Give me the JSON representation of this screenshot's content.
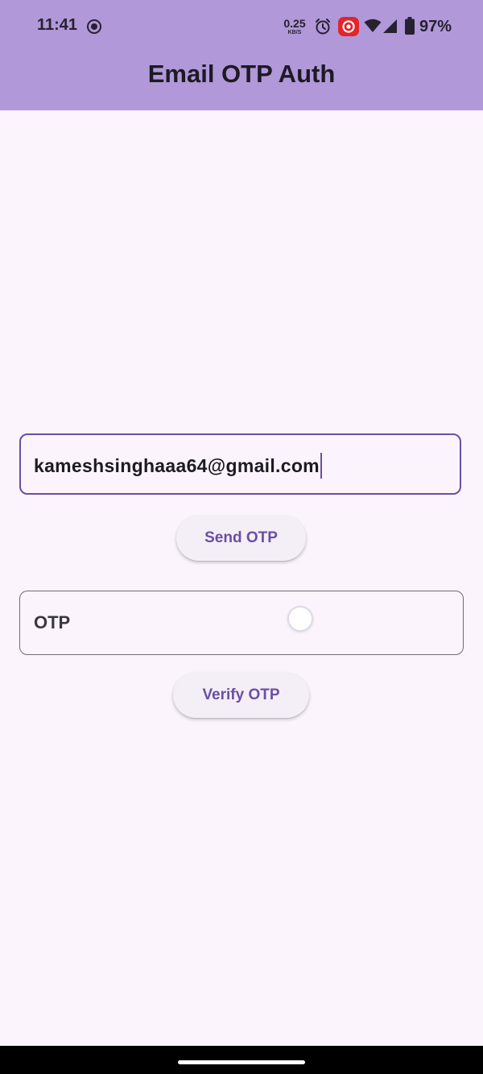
{
  "status_bar": {
    "time": "11:41",
    "net_speed_value": "0.25",
    "net_speed_unit": "KB/S",
    "battery": "97%",
    "icons": [
      "screen-record-icon",
      "alarm-icon",
      "cast-icon",
      "wifi-icon",
      "signal-icon",
      "battery-icon"
    ]
  },
  "app_bar": {
    "title": "Email OTP Auth",
    "color": "#b198d9"
  },
  "email_input": {
    "value": "kameshsinghaaa64@gmail.com",
    "focused": true
  },
  "send_button": {
    "label": "Send OTP"
  },
  "otp_input": {
    "placeholder": "OTP",
    "loading": true
  },
  "verify_button": {
    "label": "Verify OTP"
  },
  "colors": {
    "accent": "#6a4fa3",
    "background": "#fcf4fd",
    "button_background": "#f4eef7"
  }
}
